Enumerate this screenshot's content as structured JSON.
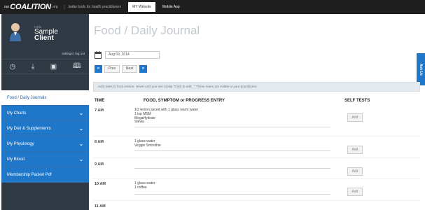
{
  "topbar": {
    "logo_our": "our",
    "logo_name": "COALITION",
    "logo_org": ".org",
    "tagline": "better tools for health practitioners",
    "tabs": [
      {
        "label": "MY Website"
      },
      {
        "label": "Mobile App"
      }
    ]
  },
  "sidebar": {
    "hello": "Hello",
    "user_first": "Sample",
    "user_last": "Client",
    "settings": "settings | log out",
    "icons": [
      "clock-icon",
      "download-icon",
      "film-icon",
      "book-icon"
    ],
    "items": [
      {
        "label": "Food / Daily Journals",
        "active": true
      },
      {
        "label": "My Charts",
        "chevron": true
      },
      {
        "label": "My Diet & Supplements",
        "chevron": true
      },
      {
        "label": "My Physiology",
        "chevron": true
      },
      {
        "label": "My Blood",
        "chevron": true
      },
      {
        "label": "Membership Packet Pdf"
      }
    ]
  },
  "main": {
    "title": "Food / Daily Journal",
    "date": "Aug 09, 2014",
    "prev_label": "Prev",
    "next_label": "Next",
    "notice": "Add notes to food entries:  Hover until you see tooltip \"Click to edit...\"  These notes are visible to your practitioner.",
    "ask_us": "Ask Us",
    "columns": {
      "time": "TIME",
      "entry": "FOOD, SYMPTOM or PROGRESS ENTRY",
      "tests": "SELF TESTS"
    },
    "add_label": "Add",
    "rows": [
      {
        "time": "7 AM",
        "lines": [
          "1/2 lemon juiced with 1 glass warm water",
          "1 tsp MSM",
          "MegaHydrate",
          "Stevia"
        ]
      },
      {
        "time": "8 AM",
        "lines": [
          "1 glass water",
          "Veggie Smoothie"
        ]
      },
      {
        "time": "9 AM",
        "lines": []
      },
      {
        "time": "10 AM",
        "lines": [
          "1 glass water",
          "1 coffee"
        ]
      },
      {
        "time": "11 AM",
        "lines": []
      }
    ]
  },
  "colors": {
    "sidebar_bg": "#2f3a44",
    "nav_blue": "#1f77c9",
    "topbar_bg": "#1f1f1f"
  }
}
